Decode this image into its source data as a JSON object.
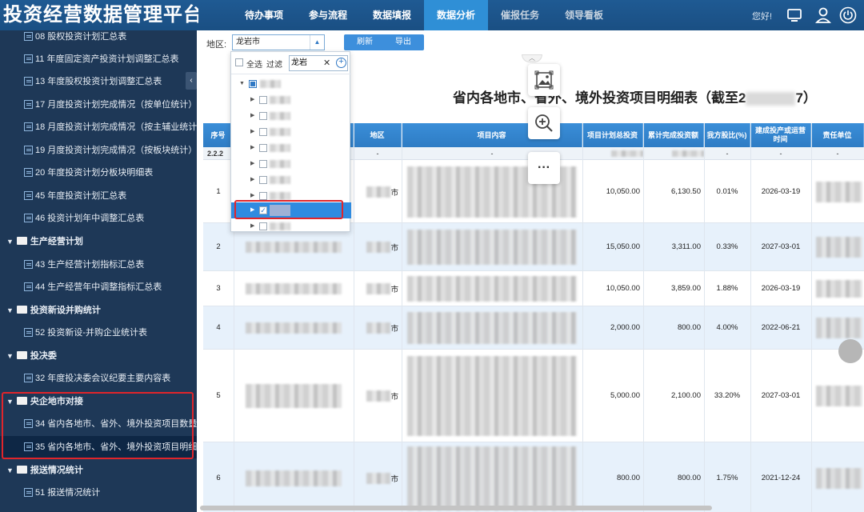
{
  "header": {
    "app_title": "投资经营数据管理平台",
    "nav_tabs": [
      {
        "label": "待办事项"
      },
      {
        "label": "参与流程"
      },
      {
        "label": "数据填报"
      },
      {
        "label": "数据分析"
      },
      {
        "label": "催报任务"
      },
      {
        "label": "领导看板"
      }
    ],
    "active_tab": "数据分析",
    "greeting": "您好!",
    "icons": [
      "monitor-icon",
      "user-icon",
      "power-icon"
    ]
  },
  "sidebar": {
    "items": [
      {
        "label": "08 股权投资计划汇总表",
        "type": "report"
      },
      {
        "label": "11 年度固定资产投资计划调整汇总表",
        "type": "report"
      },
      {
        "label": "13 年度股权投资计划调整汇总表",
        "type": "report"
      },
      {
        "label": "17 月度投资计划完成情况（按单位统计）",
        "type": "report"
      },
      {
        "label": "18 月度投资计划完成情况（按主辅业统计",
        "type": "report"
      },
      {
        "label": "19 月度投资计划完成情况（按板块统计）",
        "type": "report"
      },
      {
        "label": "20 年度投资计划分板块明细表",
        "type": "report"
      },
      {
        "label": "45 年度投资计划汇总表",
        "type": "report"
      },
      {
        "label": "46 投资计划年中调整汇总表",
        "type": "report"
      },
      {
        "label": "生产经营计划",
        "type": "group"
      },
      {
        "label": "43 生产经营计划指标汇总表",
        "type": "report"
      },
      {
        "label": "44 生产经营年中调整指标汇总表",
        "type": "report"
      },
      {
        "label": "投资新设并购统计",
        "type": "group"
      },
      {
        "label": "52 投资新设-并购企业统计表",
        "type": "report"
      },
      {
        "label": "投决委",
        "type": "group"
      },
      {
        "label": "32 年度投决委会议纪要主要内容表",
        "type": "report"
      },
      {
        "label": "央企地市对接",
        "type": "group"
      },
      {
        "label": "34 省内各地市、省外、境外投资项目数量",
        "type": "report"
      },
      {
        "label": "35 省内各地市、省外、境外投资项目明细",
        "type": "report"
      },
      {
        "label": "报送情况统计",
        "type": "group"
      },
      {
        "label": "51 报送情况统计",
        "type": "report"
      }
    ],
    "collapse_glyph": "‹"
  },
  "filter": {
    "region_label": "地区:",
    "region_value": "龙岩市",
    "refresh_label": "刷新",
    "export_label": "导出"
  },
  "dropdown": {
    "select_all_label": "全选",
    "filter_label": "过滤",
    "search_value": "龙岩",
    "clear_glyph": "✕",
    "tree_nodes": [
      {
        "level": 0,
        "expanded": true,
        "checked": "partial"
      },
      {
        "level": 1,
        "expanded": false,
        "checked": false
      },
      {
        "level": 1,
        "expanded": false,
        "checked": false
      },
      {
        "level": 1,
        "expanded": false,
        "checked": false
      },
      {
        "level": 1,
        "expanded": false,
        "checked": false
      },
      {
        "level": 1,
        "expanded": false,
        "checked": false
      },
      {
        "level": 1,
        "expanded": false,
        "checked": false
      },
      {
        "level": 1,
        "expanded": false,
        "checked": false
      },
      {
        "level": 1,
        "expanded": false,
        "checked": true,
        "selected": true
      },
      {
        "level": 1,
        "expanded": false,
        "checked": false
      }
    ]
  },
  "report": {
    "title_prefix": "省内各地市、省外、境外投资项目明细表（截至2",
    "title_suffix": "7）",
    "columns": [
      "序号",
      "",
      "地区",
      "项目内容",
      "项目计划总投资",
      "累计完成投资额",
      "我方股比(%)",
      "建成投产或运营时间",
      "责任单位"
    ],
    "subrow": {
      "seq": "2.2.2",
      "dash": "-"
    },
    "rows": [
      {
        "seq": "1",
        "region_suffix": "市",
        "planned": "10,050.00",
        "completed": "6,130.50",
        "share": "0.01%",
        "time": "2026-03-19"
      },
      {
        "seq": "2",
        "region_suffix": "市",
        "planned": "15,050.00",
        "completed": "3,311.00",
        "share": "0.33%",
        "time": "2027-03-01"
      },
      {
        "seq": "3",
        "region_suffix": "市",
        "planned": "10,050.00",
        "completed": "3,859.00",
        "share": "1.88%",
        "time": "2026-03-19"
      },
      {
        "seq": "4",
        "region_suffix": "市",
        "planned": "2,000.00",
        "completed": "800.00",
        "share": "4.00%",
        "time": "2022-06-21"
      },
      {
        "seq": "5",
        "region_suffix": "市",
        "planned": "5,000.00",
        "completed": "2,100.00",
        "share": "33.20%",
        "time": "2027-03-01"
      },
      {
        "seq": "6",
        "region_suffix": "市",
        "planned": "800.00",
        "completed": "800.00",
        "share": "1.75%",
        "time": "2021-12-24"
      }
    ]
  },
  "floating_tools": {
    "icons": [
      "image-icon",
      "zoom-in-icon",
      "more-icon"
    ],
    "more_glyph": "···"
  }
}
